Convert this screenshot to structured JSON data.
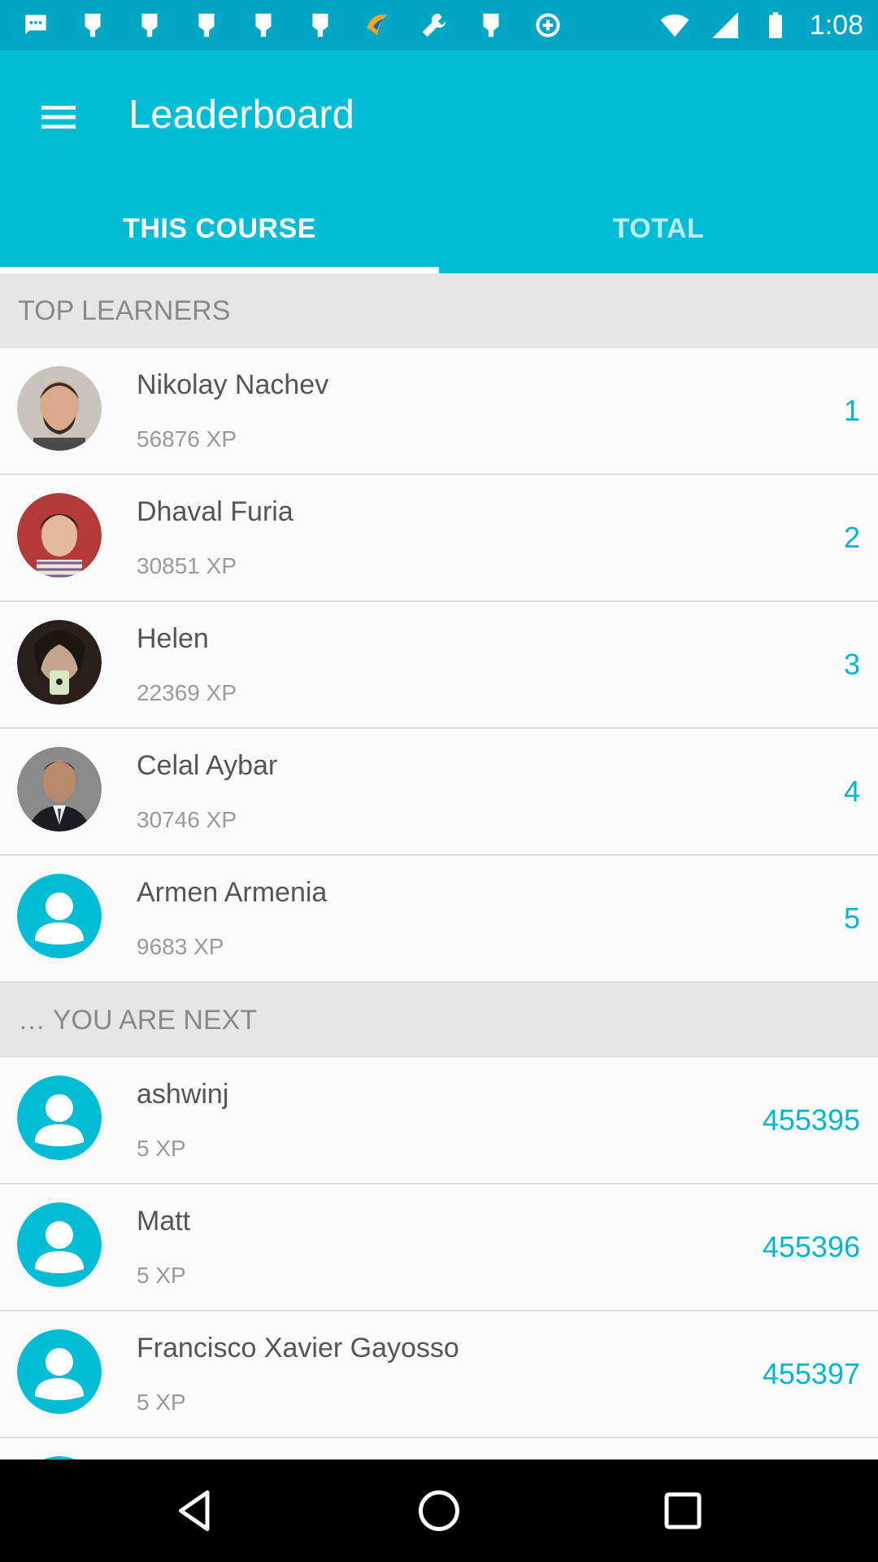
{
  "status_bar": {
    "time": "1:08",
    "left_icons": [
      "messages-icon",
      "maps-pin-icon",
      "maps-pin-icon",
      "maps-pin-icon",
      "maps-pin-icon",
      "maps-pin-icon",
      "app-logo-icon",
      "wrench-icon",
      "maps-pin-icon",
      "data-saver-icon"
    ],
    "right_icons": [
      "wifi-icon",
      "signal-icon",
      "battery-icon"
    ]
  },
  "app_bar": {
    "title": "Leaderboard",
    "tabs": [
      {
        "label": "THIS COURSE",
        "active": true
      },
      {
        "label": "TOTAL",
        "active": false
      }
    ]
  },
  "sections": {
    "top_learners_header": "TOP LEARNERS",
    "next_header": "… YOU ARE NEXT"
  },
  "top_learners": [
    {
      "name": "Nikolay Nachev",
      "xp": "56876 XP",
      "rank": "1",
      "avatar": "photo-avatar"
    },
    {
      "name": "Dhaval Furia",
      "xp": "30851 XP",
      "rank": "2",
      "avatar": "photo-avatar"
    },
    {
      "name": "Helen",
      "xp": "22369 XP",
      "rank": "3",
      "avatar": "photo-avatar"
    },
    {
      "name": "Celal Aybar",
      "xp": "30746 XP",
      "rank": "4",
      "avatar": "photo-avatar"
    },
    {
      "name": "Armen Armenia",
      "xp": "9683 XP",
      "rank": "5",
      "avatar": "default-user-icon"
    }
  ],
  "next_learners": [
    {
      "name": "ashwinj",
      "xp": "5 XP",
      "rank": "455395",
      "avatar": "default-user-icon"
    },
    {
      "name": "Matt",
      "xp": "5 XP",
      "rank": "455396",
      "avatar": "default-user-icon"
    },
    {
      "name": "Francisco Xavier Gayosso",
      "xp": "5 XP",
      "rank": "455397",
      "avatar": "default-user-icon"
    }
  ],
  "colors": {
    "status_bar": "#00a6c4",
    "primary": "#00bcd4",
    "accent_text": "#00b5d0",
    "header_bg": "#e6e6e6"
  },
  "nav_bar": {
    "buttons": [
      "back-icon",
      "home-icon",
      "recents-icon"
    ]
  }
}
